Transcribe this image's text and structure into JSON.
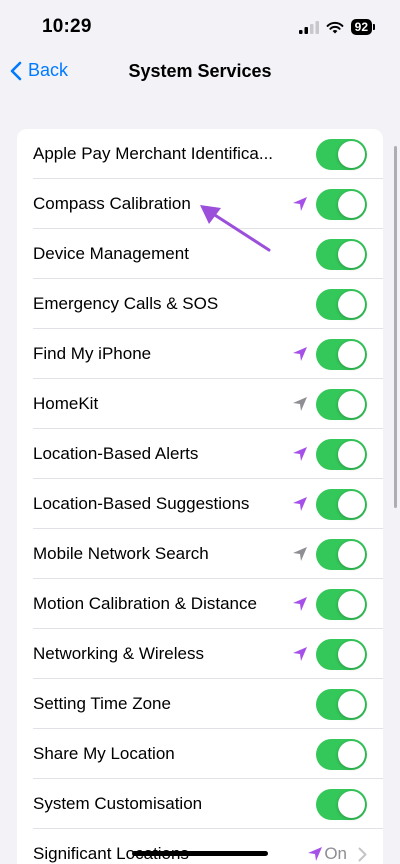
{
  "status_bar": {
    "time": "10:29",
    "battery": "92"
  },
  "nav": {
    "back_label": "Back",
    "title": "System Services"
  },
  "colors": {
    "accent": "#007aff",
    "toggle_on": "#34c759",
    "location_purple": "#a550e8",
    "location_gray": "#8e8e93",
    "annotation": "#9b4fdb"
  },
  "rows": [
    {
      "label": "Apple Pay Merchant Identifica...",
      "toggle": true,
      "location_icon": null
    },
    {
      "label": "Compass Calibration",
      "toggle": true,
      "location_icon": "purple"
    },
    {
      "label": "Device Management",
      "toggle": true,
      "location_icon": null
    },
    {
      "label": "Emergency Calls & SOS",
      "toggle": true,
      "location_icon": null
    },
    {
      "label": "Find My iPhone",
      "toggle": true,
      "location_icon": "purple"
    },
    {
      "label": "HomeKit",
      "toggle": true,
      "location_icon": "gray"
    },
    {
      "label": "Location-Based Alerts",
      "toggle": true,
      "location_icon": "purple"
    },
    {
      "label": "Location-Based Suggestions",
      "toggle": true,
      "location_icon": "purple"
    },
    {
      "label": "Mobile Network Search",
      "toggle": true,
      "location_icon": "gray"
    },
    {
      "label": "Motion Calibration & Distance",
      "toggle": true,
      "location_icon": "purple"
    },
    {
      "label": "Networking & Wireless",
      "toggle": true,
      "location_icon": "purple"
    },
    {
      "label": "Setting Time Zone",
      "toggle": true,
      "location_icon": null
    },
    {
      "label": "Share My Location",
      "toggle": true,
      "location_icon": null
    },
    {
      "label": "System Customisation",
      "toggle": true,
      "location_icon": null
    },
    {
      "label": "Significant Locations",
      "value": "On",
      "location_icon": "purple"
    }
  ]
}
